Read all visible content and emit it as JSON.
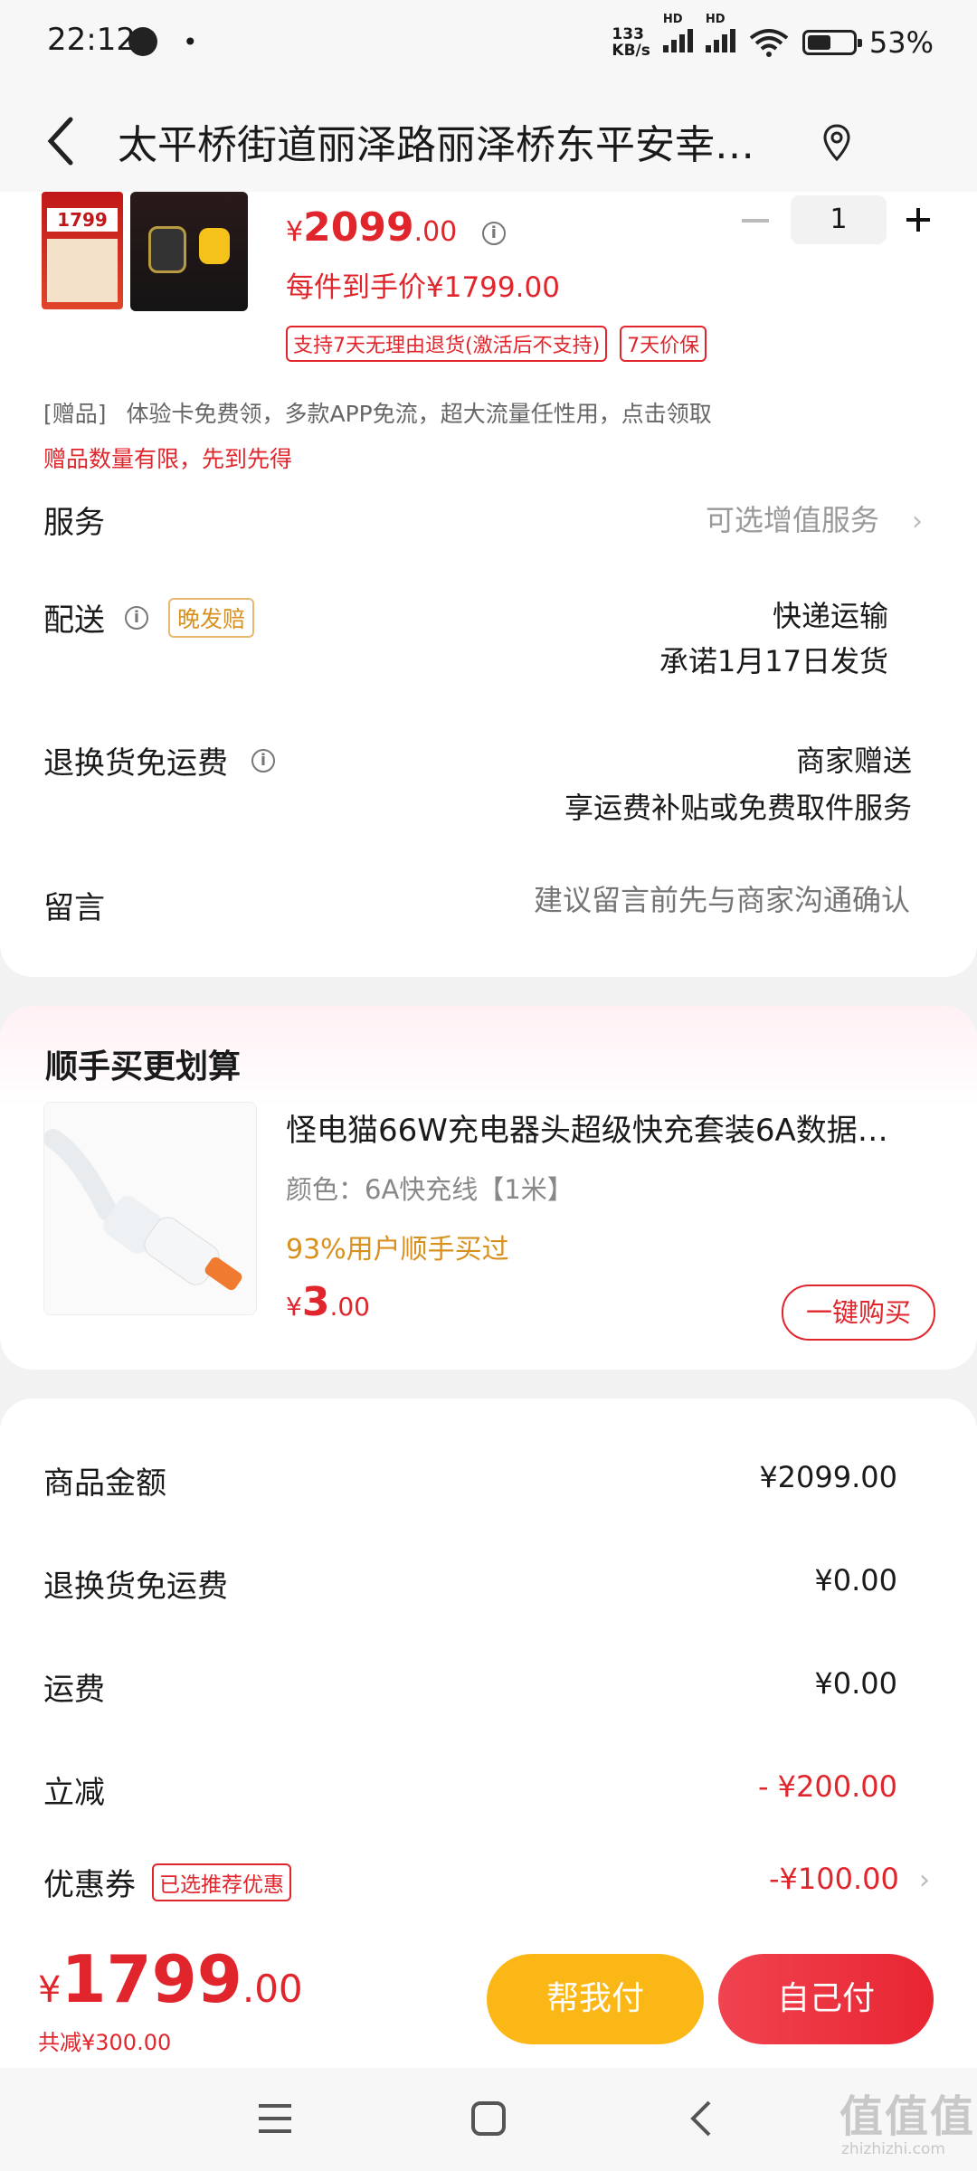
{
  "status_bar": {
    "time": "22:12",
    "net_speed_top": "133",
    "net_speed_unit": "KB/s",
    "hd1": "HD",
    "hd2": "HD",
    "battery_level": 0.53,
    "battery_text": "53%"
  },
  "header": {
    "title": "太平桥街道丽泽路丽泽桥东平安幸…"
  },
  "product": {
    "img_badge": "1799",
    "price_symbol": "¥",
    "price_int": "2099",
    "price_dec": ".00",
    "final_price_label": "每件到手价¥1799.00",
    "quantity": "1",
    "tags": [
      "支持7天无理由退货(激活后不支持)",
      "7天价保"
    ],
    "gift_label": "[赠品]",
    "gift_text": "体验卡免费领，多款APP免流，超大流量任性用，点击领取",
    "gift_limit": "赠品数量有限，先到先得"
  },
  "rows": {
    "service_label": "服务",
    "service_value": "可选增值服务",
    "delivery_label": "配送",
    "delivery_badge": "晚发赔",
    "delivery_value1": "快递运输",
    "delivery_value2": "承诺1月17日发货",
    "return_label": "退换货免运费",
    "return_value1": "商家赠送",
    "return_value2": "享运费补贴或免费取件服务",
    "message_label": "留言",
    "message_placeholder": "建议留言前先与商家沟通确认"
  },
  "addon": {
    "section_title": "顺手买更划算",
    "name": "怪电猫66W充电器头超级快充套装6A数据…",
    "variant": "颜色：6A快充线【1米】",
    "social": "93%用户顺手买过",
    "price_symbol": "¥",
    "price_int": "3",
    "price_dec": ".00",
    "buy_button": "一键购买"
  },
  "summary": {
    "items": [
      {
        "label": "商品金额",
        "value": "¥2099.00"
      },
      {
        "label": "退换货免运费",
        "value": "¥0.00"
      },
      {
        "label": "运费",
        "value": "¥0.00"
      },
      {
        "label": "立减",
        "value": "- ¥200.00"
      },
      {
        "label": "优惠券",
        "value": "-¥100.00"
      }
    ],
    "coupon_tag": "已选推荐优惠"
  },
  "footer": {
    "price_symbol": "¥",
    "price_int": "1799",
    "price_dec": ".00",
    "saved": "共减¥300.00",
    "help_pay": "帮我付",
    "self_pay": "自己付"
  },
  "watermark": {
    "text": "值值值",
    "sub": "zhizhizhi.com"
  },
  "colors": {
    "accent_red": "#e0262c",
    "help_pay_bg": "#fbb715",
    "self_pay_bg": "#ee2f3a",
    "social_orange": "#d8901e"
  }
}
